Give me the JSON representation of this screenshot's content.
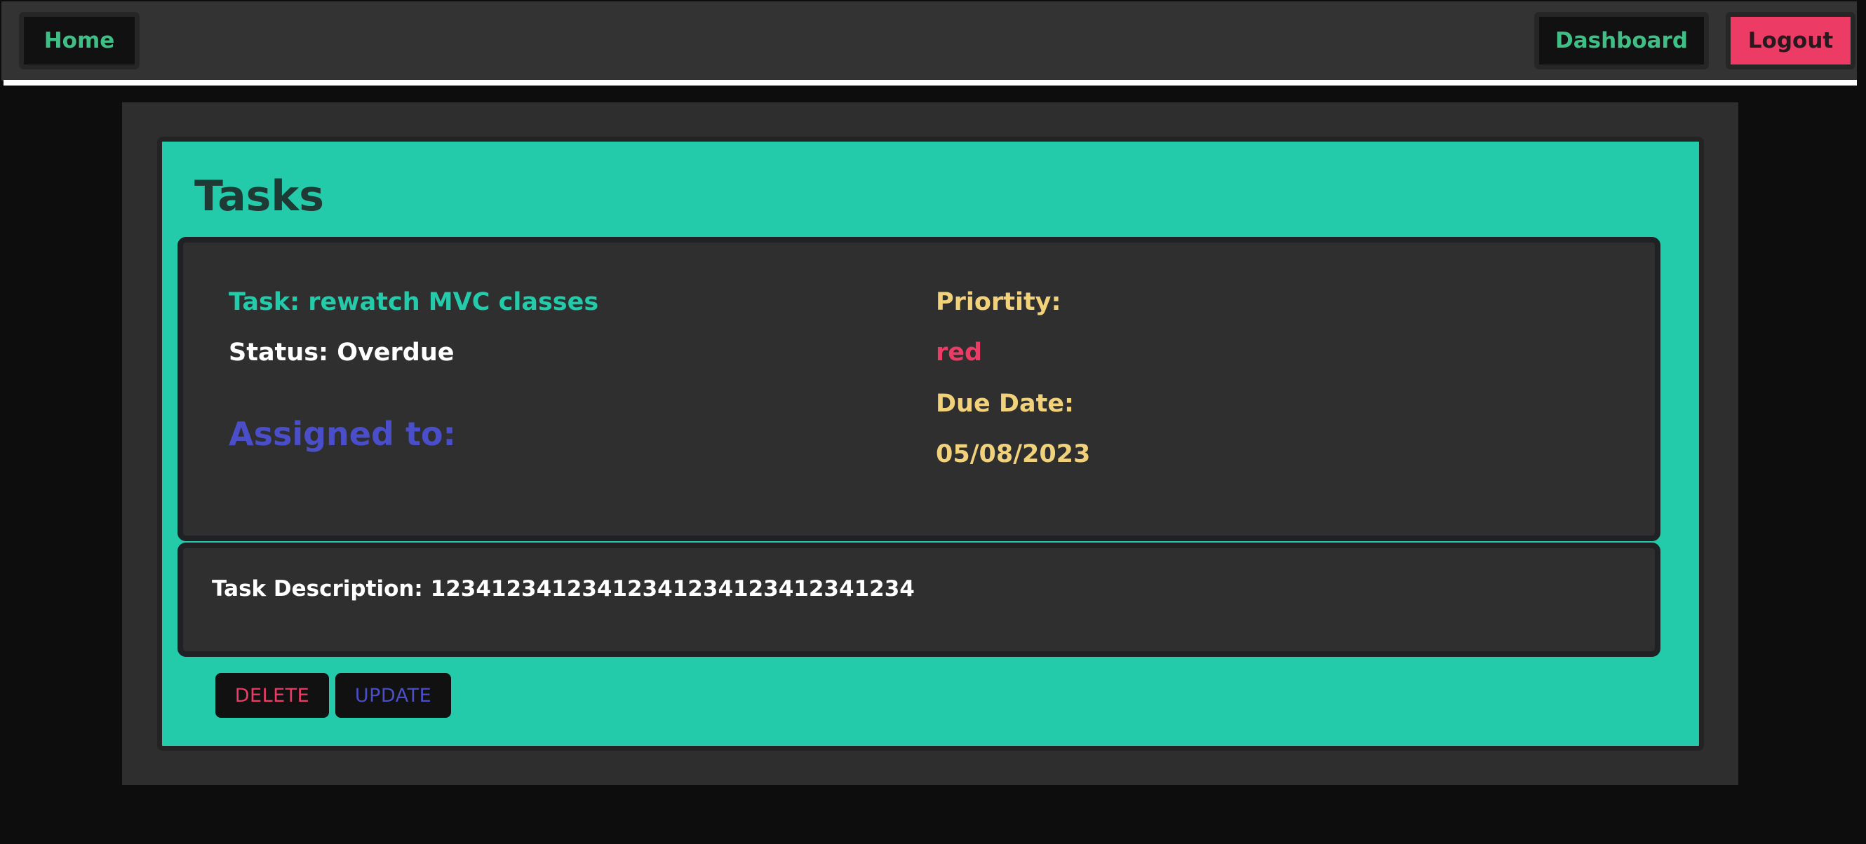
{
  "navbar": {
    "home_label": "Home",
    "dashboard_label": "Dashboard",
    "logout_label": "Logout"
  },
  "tasks": {
    "title": "Tasks",
    "task_name": "Task: rewatch MVC classes",
    "status": "Status: Overdue",
    "assigned_to": "Assigned to:",
    "priority_label": "Priortity:",
    "priority_value": "red",
    "due_date_label": "Due Date:",
    "due_date_value": "05/08/2023",
    "description": "Task Description: 12341234123412341234123412341234",
    "delete_label": "DELETE",
    "update_label": "UPDATE"
  },
  "colors": {
    "accent_teal": "#23cbaa",
    "nav_green": "#3fbf86",
    "logout_pink": "#ec3c66",
    "assigned_blue": "#4a4fc9",
    "due_yellow": "#f1d27a",
    "card_bg": "#2f2f2f"
  }
}
